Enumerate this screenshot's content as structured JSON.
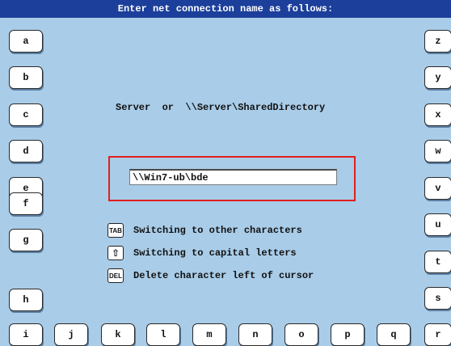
{
  "header": {
    "title": "Enter net connection name as follows:"
  },
  "keyboard": {
    "left": [
      "a",
      "b",
      "c",
      "d",
      "e",
      "f",
      "g",
      "h"
    ],
    "right": [
      "z",
      "y",
      "x",
      "w",
      "v",
      "u",
      "t",
      "s",
      "r"
    ],
    "bottom": [
      "i",
      "j",
      "k",
      "l",
      "m",
      "n",
      "o",
      "p",
      "q"
    ]
  },
  "prompt": {
    "format_hint": "Server  or  \\\\Server\\SharedDirectory"
  },
  "input": {
    "value": "\\\\Win7-ub\\bde"
  },
  "legend": {
    "tab_badge": "TAB",
    "tab_label": "Switching to other characters",
    "shift_badge": "⇧",
    "shift_label": "Switching to capital letters",
    "del_badge": "DEL",
    "del_label": "Delete character left of cursor"
  },
  "colors": {
    "background": "#a9cce8",
    "titlebar": "#1c3f9b",
    "highlight": "#e0201e"
  }
}
